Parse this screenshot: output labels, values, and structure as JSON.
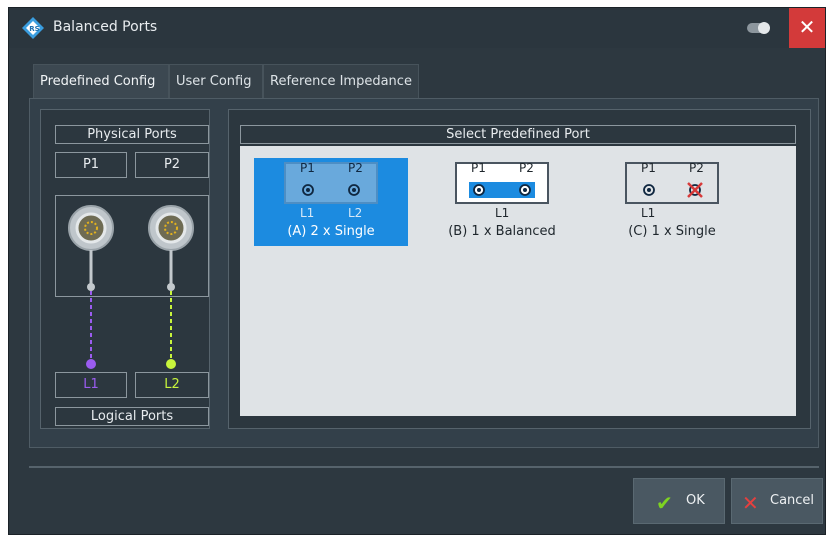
{
  "window": {
    "title": "Balanced Ports",
    "close_glyph": "✕",
    "icon": "rohde-schwarz-logo-icon"
  },
  "tabs": [
    {
      "label": "Predefined Config",
      "active": true
    },
    {
      "label": "User Config",
      "active": false
    },
    {
      "label": "Reference Impedance",
      "active": false
    }
  ],
  "left_panel": {
    "physical_ports_label": "Physical Ports",
    "logical_ports_label": "Logical Ports",
    "physical_ports": [
      "P1",
      "P2"
    ],
    "logical_ports": [
      "L1",
      "L2"
    ],
    "logical_colors": [
      "#9b5cf0",
      "#c8f53c"
    ]
  },
  "right_panel": {
    "title": "Select Predefined Port",
    "options": [
      {
        "caption": "(A) 2 x Single",
        "p1": "P1",
        "p2": "P2",
        "l1": "L1",
        "l2": "L2",
        "selected": true
      },
      {
        "caption": "(B) 1 x Balanced",
        "p1": "P1",
        "p2": "P2",
        "l1": "L1",
        "selected": false
      },
      {
        "caption": "(C) 1 x Single",
        "p1": "P1",
        "p2": "P2",
        "l1": "L1",
        "selected": false
      }
    ]
  },
  "buttons": {
    "ok_label": "OK",
    "ok_glyph": "✔",
    "cancel_label": "Cancel",
    "cancel_glyph": "✕"
  },
  "colors": {
    "accent": "#1c8be0",
    "ok_green": "#7ed321",
    "cancel_red": "#e5403f"
  }
}
